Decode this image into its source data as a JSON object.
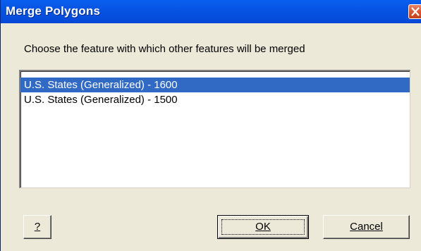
{
  "dialog": {
    "title": "Merge Polygons",
    "instruction": "Choose the feature with which other features will be merged"
  },
  "features_list": {
    "items": [
      {
        "label": "U.S. States (Generalized) - 1600",
        "selected": true
      },
      {
        "label": "U.S. States (Generalized) - 1500",
        "selected": false
      }
    ]
  },
  "buttons": {
    "help_label": "?",
    "ok_label": "OK",
    "cancel_label": "Cancel"
  },
  "icons": {
    "close": "close-icon"
  },
  "colors": {
    "titlebar": "#0554e3",
    "selection": "#316ac5",
    "close_button": "#d9582f",
    "dialog_background": "#ece9d8"
  }
}
